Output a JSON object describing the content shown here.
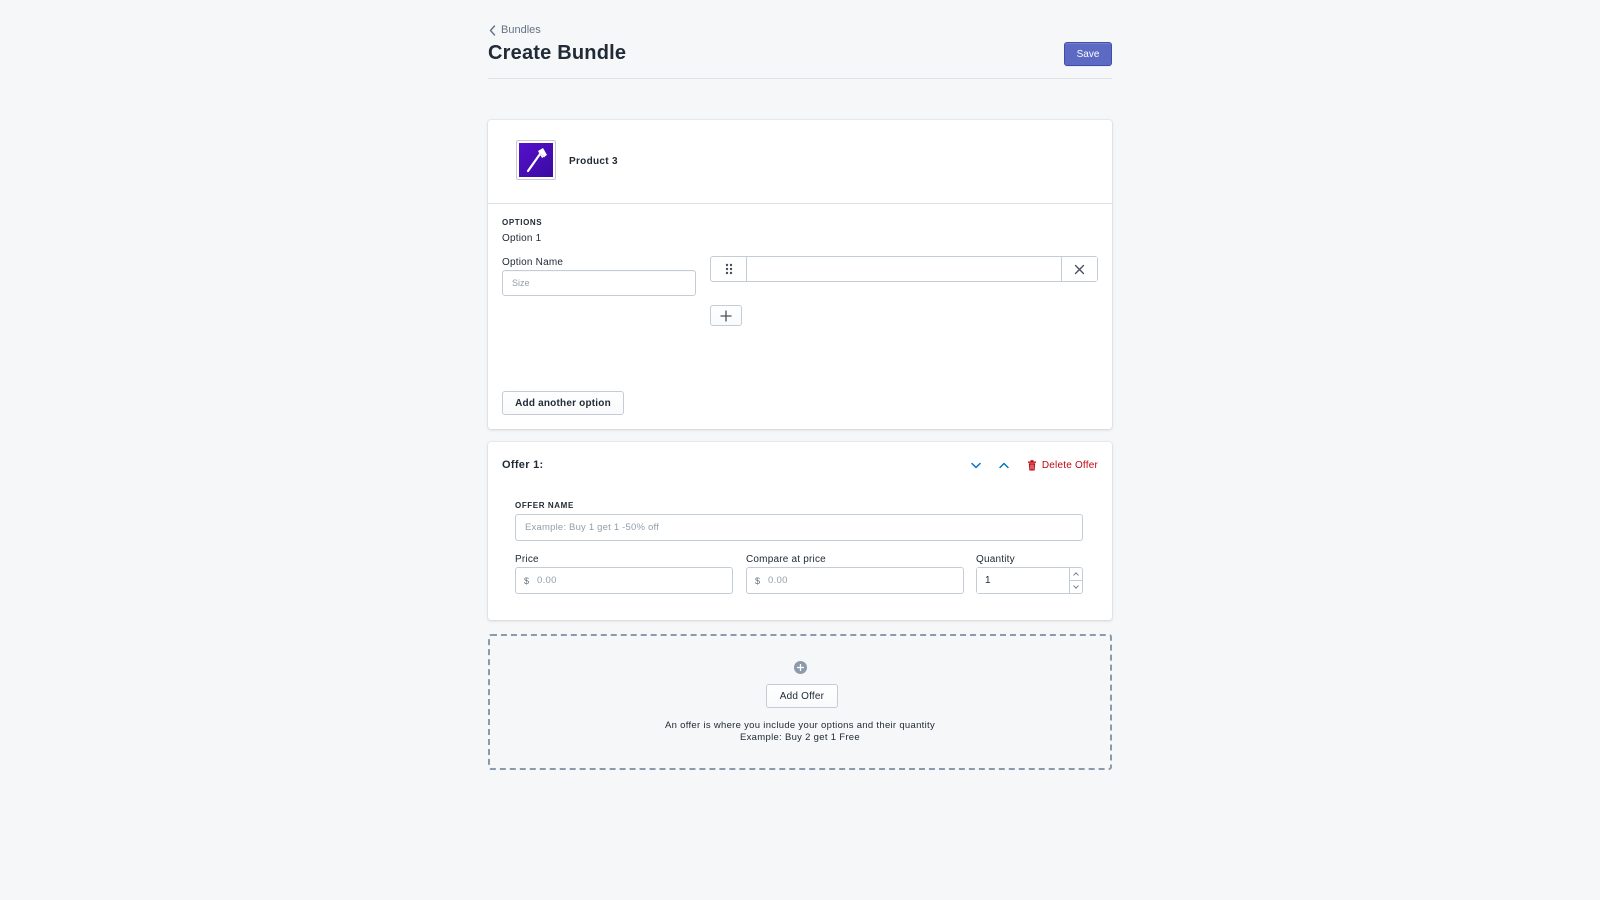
{
  "header": {
    "breadcrumb": "Bundles",
    "title": "Create Bundle",
    "save_label": "Save"
  },
  "product": {
    "name": "Product 3",
    "thumb_color": "#5511cc"
  },
  "options": {
    "heading": "OPTIONS",
    "option_title": "Option 1",
    "option_name_label": "Option Name",
    "option_name_placeholder": "Size",
    "option_name_value": "",
    "value": "",
    "add_option_label": "Add another option"
  },
  "offer": {
    "title": "Offer 1:",
    "delete_label": "Delete Offer",
    "name_label": "OFFER NAME",
    "name_placeholder": "Example: Buy 1 get 1 -50% off",
    "price_label": "Price",
    "price_prefix": "$",
    "price_placeholder": "0.00",
    "compare_label": "Compare at price",
    "compare_prefix": "$",
    "compare_placeholder": "0.00",
    "quantity_label": "Quantity",
    "quantity_value": "1"
  },
  "add_offer": {
    "button_label": "Add Offer",
    "help_line1": "An offer is where you include your options and their quantity",
    "help_line2": "Example: Buy 2 get 1 Free"
  },
  "colors": {
    "primary": "#5c6ac4",
    "destructive": "#bf0711",
    "link_blue": "#006fbb",
    "background": "#f6f7f9"
  }
}
